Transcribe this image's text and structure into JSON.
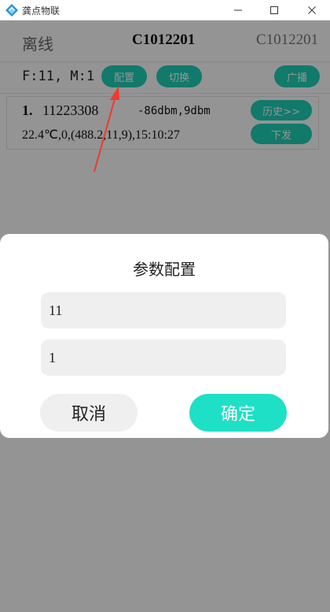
{
  "window": {
    "title": "龚点物联",
    "accent": "#1ed2b8",
    "logo_icon": "app-logo-icon"
  },
  "topbar": {
    "status": "离线",
    "device_title": "C1012201",
    "device_id": "C1012201"
  },
  "controls": {
    "fm_label": "F:11, M:1",
    "config_label": "配置",
    "switch_label": "切换",
    "broadcast_label": "广播"
  },
  "device_card": {
    "index": "1.",
    "node_id": "11223308",
    "signal": "-86dbm,9dbm",
    "reading": "22.4℃,0,(488.2,11,9),15:10:27",
    "history_label": "历史>>",
    "send_label": "下发"
  },
  "dialog": {
    "title": "参数配置",
    "f_value": "11",
    "m_value": "1",
    "cancel_label": "取消",
    "confirm_label": "确定"
  }
}
